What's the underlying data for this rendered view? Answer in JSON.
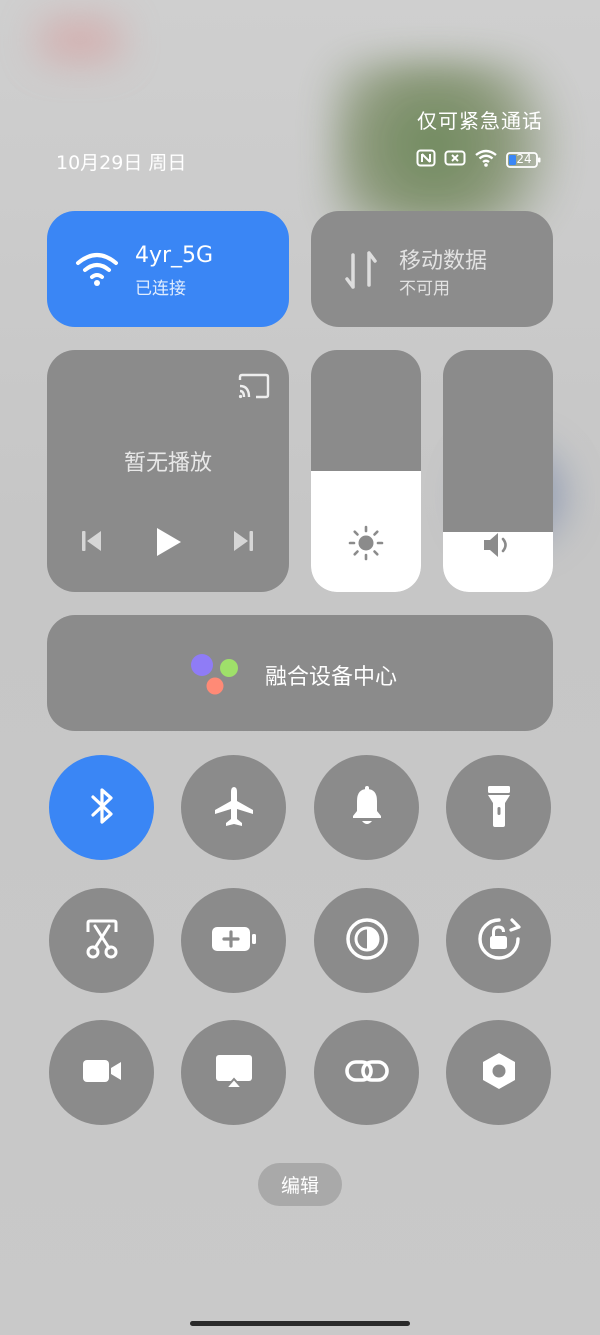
{
  "status": {
    "emergency_text": "仅可紧急通话",
    "date": "10月29日 周日",
    "battery": "24"
  },
  "wifi": {
    "name": "4yr_5G",
    "status": "已连接",
    "icon": "wifi-icon",
    "active": true
  },
  "mobile_data": {
    "name": "移动数据",
    "status": "不可用",
    "icon": "mobile-data-icon",
    "active": false
  },
  "media": {
    "status": "暂无播放"
  },
  "sliders": {
    "brightness": 0.5,
    "volume": 0.25
  },
  "fusion": {
    "label": "融合设备中心"
  },
  "toggles": [
    {
      "icon": "bluetooth-icon",
      "active": true
    },
    {
      "icon": "airplane-icon",
      "active": false
    },
    {
      "icon": "bell-icon",
      "active": false
    },
    {
      "icon": "flashlight-icon",
      "active": false
    },
    {
      "icon": "screenshot-icon",
      "active": false
    },
    {
      "icon": "battery-saver-icon",
      "active": false
    },
    {
      "icon": "dark-mode-icon",
      "active": false
    },
    {
      "icon": "rotation-lock-icon",
      "active": false
    },
    {
      "icon": "screen-record-icon",
      "active": false
    },
    {
      "icon": "screen-cast-icon",
      "active": false
    },
    {
      "icon": "link-icon",
      "active": false
    },
    {
      "icon": "settings-hex-icon",
      "active": false
    }
  ],
  "edit_label": "编辑",
  "colors": {
    "accent": "#3a86f5",
    "tile": "#8b8b8b"
  }
}
